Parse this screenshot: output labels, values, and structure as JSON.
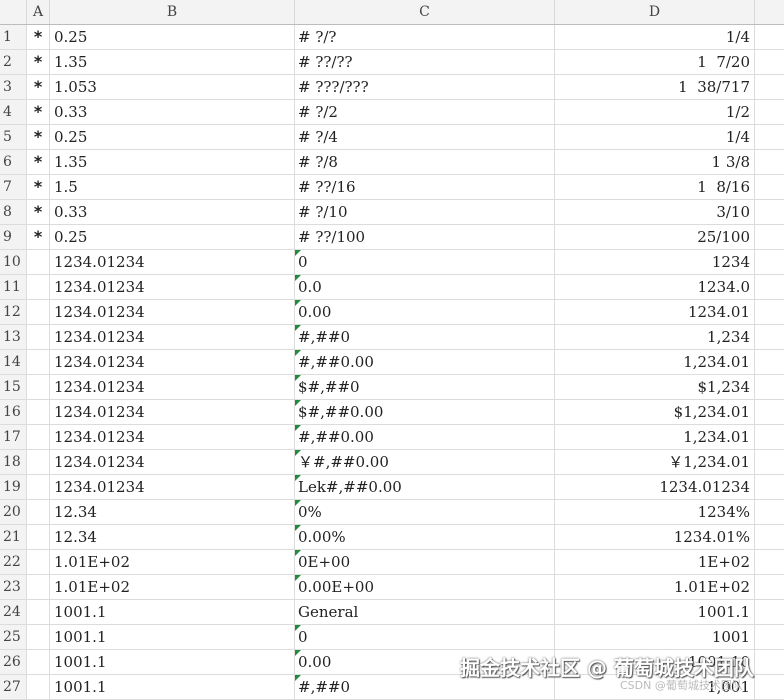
{
  "columns": [
    "A",
    "B",
    "C",
    "D"
  ],
  "rows": [
    {
      "n": "1",
      "a": "*",
      "b": "0.25",
      "c": "# ?/?",
      "d": "1/4",
      "t": false
    },
    {
      "n": "2",
      "a": "*",
      "b": "1.35",
      "c": "# ??/??",
      "d": "1  7/20",
      "t": false
    },
    {
      "n": "3",
      "a": "*",
      "b": "1.053",
      "c": "# ???/???",
      "d": "1  38/717",
      "t": false
    },
    {
      "n": "4",
      "a": "*",
      "b": "0.33",
      "c": "# ?/2",
      "d": "1/2",
      "t": false
    },
    {
      "n": "5",
      "a": "*",
      "b": "0.25",
      "c": "# ?/4",
      "d": "1/4",
      "t": false
    },
    {
      "n": "6",
      "a": "*",
      "b": "1.35",
      "c": "# ?/8",
      "d": "1 3/8",
      "t": false
    },
    {
      "n": "7",
      "a": "*",
      "b": "1.5",
      "c": "# ??/16",
      "d": "1  8/16",
      "t": false
    },
    {
      "n": "8",
      "a": "*",
      "b": "0.33",
      "c": "# ?/10",
      "d": "3/10",
      "t": false
    },
    {
      "n": "9",
      "a": "*",
      "b": "0.25",
      "c": "# ??/100",
      "d": "25/100",
      "t": false
    },
    {
      "n": "10",
      "a": "",
      "b": "1234.01234",
      "c": "0",
      "d": "1234",
      "t": true
    },
    {
      "n": "11",
      "a": "",
      "b": "1234.01234",
      "c": "0.0",
      "d": "1234.0",
      "t": true
    },
    {
      "n": "12",
      "a": "",
      "b": "1234.01234",
      "c": "0.00",
      "d": "1234.01",
      "t": true
    },
    {
      "n": "13",
      "a": "",
      "b": "1234.01234",
      "c": "#,##0",
      "d": "1,234",
      "t": true
    },
    {
      "n": "14",
      "a": "",
      "b": "1234.01234",
      "c": "#,##0.00",
      "d": "1,234.01",
      "t": true
    },
    {
      "n": "15",
      "a": "",
      "b": "1234.01234",
      "c": "$#,##0",
      "d": "$1,234",
      "t": true
    },
    {
      "n": "16",
      "a": "",
      "b": "1234.01234",
      "c": "$#,##0.00",
      "d": "$1,234.01",
      "t": true
    },
    {
      "n": "17",
      "a": "",
      "b": "1234.01234",
      "c": "#,##0.00",
      "d": "1,234.01",
      "t": true
    },
    {
      "n": "18",
      "a": "",
      "b": "1234.01234",
      "c": "￥#,##0.00",
      "d": "￥1,234.01",
      "t": true
    },
    {
      "n": "19",
      "a": "",
      "b": "1234.01234",
      "c": "Lek#,##0.00",
      "d": "1234.01234",
      "t": true
    },
    {
      "n": "20",
      "a": "",
      "b": "12.34",
      "c": "0%",
      "d": "1234%",
      "t": true
    },
    {
      "n": "21",
      "a": "",
      "b": "12.34",
      "c": "0.00%",
      "d": "1234.01%",
      "t": true
    },
    {
      "n": "22",
      "a": "",
      "b": "1.01E+02",
      "c": "0E+00",
      "d": "1E+02",
      "t": true
    },
    {
      "n": "23",
      "a": "",
      "b": "1.01E+02",
      "c": "0.00E+00",
      "d": "1.01E+02",
      "t": true
    },
    {
      "n": "24",
      "a": "",
      "b": "1001.1",
      "c": "General",
      "d": "1001.1",
      "t": false
    },
    {
      "n": "25",
      "a": "",
      "b": "1001.1",
      "c": "0",
      "d": "1001",
      "t": true
    },
    {
      "n": "26",
      "a": "",
      "b": "1001.1",
      "c": "0.00",
      "d": "1001.10",
      "t": true
    },
    {
      "n": "27",
      "a": "",
      "b": "1001.1",
      "c": "#,##0",
      "d": "1,001",
      "t": true
    }
  ],
  "watermark": "掘金技术社区 @ 葡萄城技术团队",
  "watermark2": "CSDN @葡萄城技术团队"
}
